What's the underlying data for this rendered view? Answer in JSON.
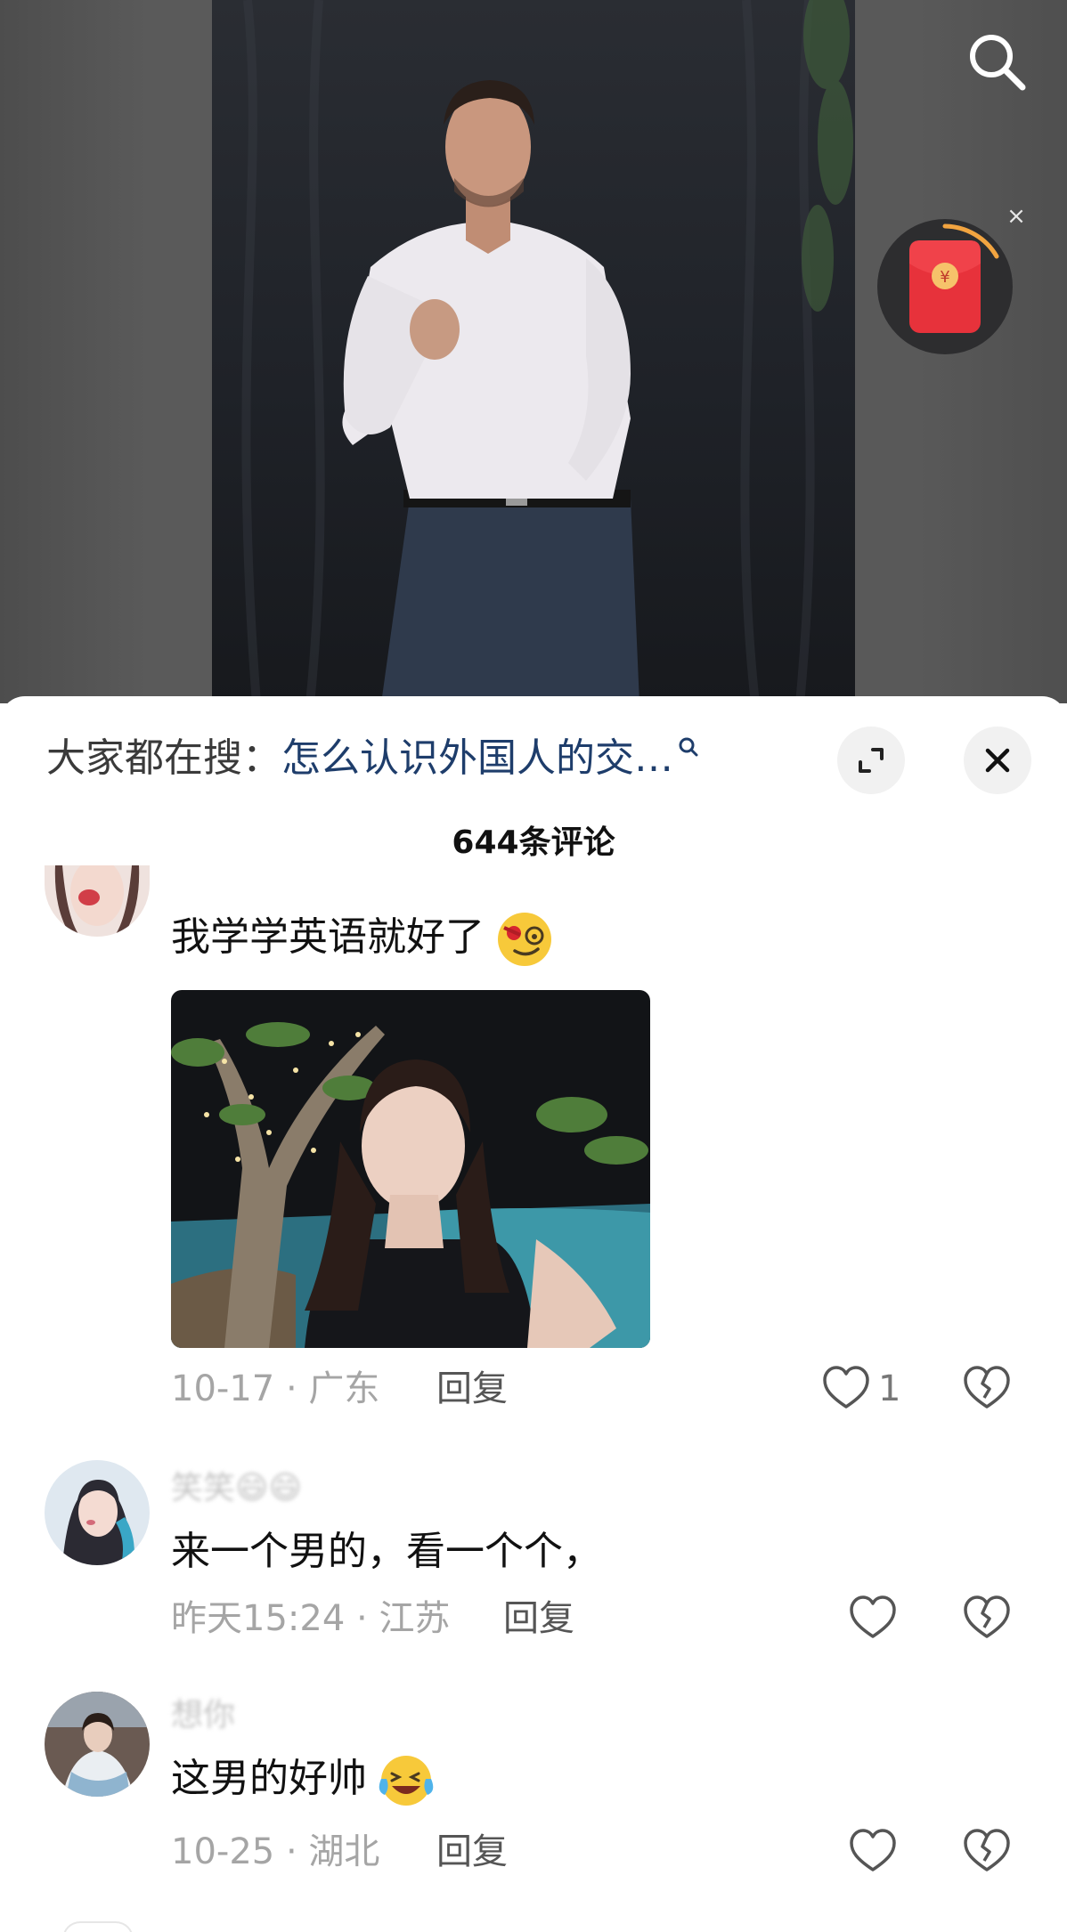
{
  "top_bar": {
    "search_icon": "search-icon"
  },
  "red_packet": {
    "icon": "red-packet-icon",
    "currency_symbol": "¥",
    "close_label": "×"
  },
  "comment_panel": {
    "search_suggest": {
      "prefix": "大家都在搜：",
      "query": "怎么认识外国人的交…",
      "icon": "mini-search-icon"
    },
    "expand_icon": "expand-icon",
    "close_icon": "close-icon",
    "comment_count": "644条评论",
    "comments": [
      {
        "username": "",
        "text": "我学学英语就好了",
        "emoji": "cool-face-emoji",
        "has_image": true,
        "date": "10-17",
        "location": "广东",
        "reply_label": "回复",
        "likes": "1"
      },
      {
        "username": "笑笑😄😄",
        "text": "来一个男的，看一个个，",
        "date": "昨天15:24",
        "location": "江苏",
        "reply_label": "回复",
        "likes": ""
      },
      {
        "username": "想你",
        "text": "这男的好帅",
        "emoji": "laughing-crying-emoji",
        "date": "10-25",
        "location": "湖北",
        "reply_label": "回复",
        "likes": ""
      }
    ],
    "meta_separator": " · "
  },
  "colors": {
    "query_text": "#1e3d6b",
    "meta_text": "#a5a5a5",
    "red_packet": "#e7323b"
  }
}
